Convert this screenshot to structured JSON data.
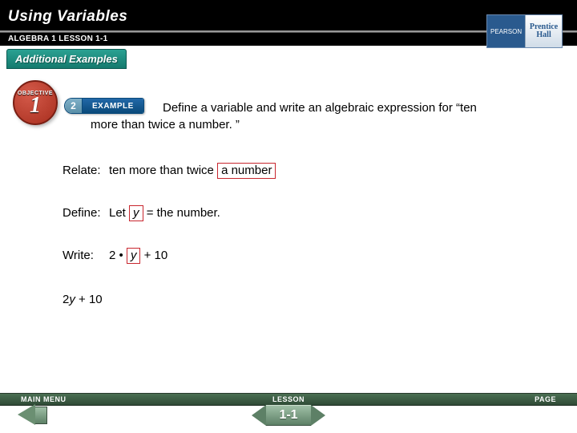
{
  "title": "Using Variables",
  "subtitle": "ALGEBRA 1   LESSON 1-1",
  "tab_label": "Additional Examples",
  "publisher": {
    "brand": "PEARSON",
    "imprint_line1": "Prentice",
    "imprint_line2": "Hall"
  },
  "objective": {
    "label": "OBJECTIVE",
    "number": "1"
  },
  "example": {
    "number": "2",
    "label": "EXAMPLE"
  },
  "problem": {
    "line1": "Define a variable and write an algebraic expression for “ten",
    "line2": "more than twice a number. ”"
  },
  "relate": {
    "label": "Relate:",
    "text_before": "ten more than twice ",
    "boxed": "a number"
  },
  "define": {
    "label": "Define:",
    "text_before": "Let ",
    "boxed_var": "y",
    "text_after": " = the number."
  },
  "write": {
    "label": "Write:",
    "text_before": "2 • ",
    "boxed_var": "y",
    "text_after": " + 10"
  },
  "final_answer": {
    "coeff": "2",
    "var": "y",
    "rest": " + 10"
  },
  "nav": {
    "main_menu": "MAIN MENU",
    "lesson": "LESSON",
    "page": "PAGE",
    "lesson_num": "1-1"
  }
}
